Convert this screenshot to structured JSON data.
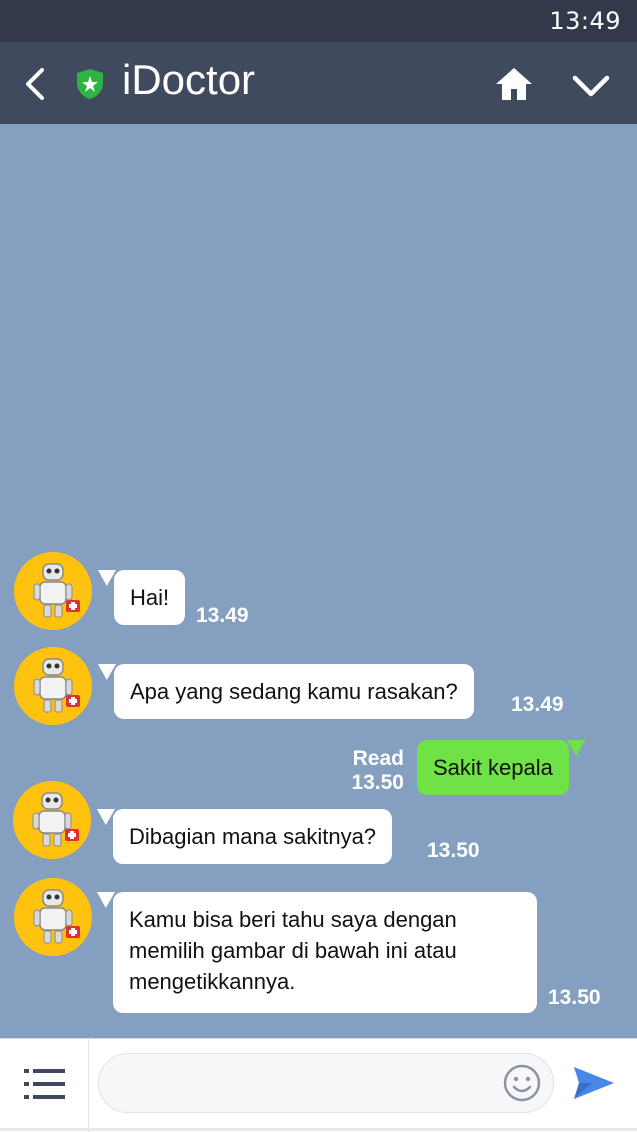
{
  "status_bar": {
    "time": "13:49"
  },
  "header": {
    "title": "iDoctor",
    "icons": {
      "back": "back-chevron-icon",
      "badge": "verified-shield-icon",
      "home": "home-icon",
      "more": "chevron-down-icon"
    },
    "colors": {
      "bar": "#3f4a5e",
      "status": "#31394a",
      "shield": "#2fb343"
    }
  },
  "chat": {
    "background": "#849fc0",
    "messages": [
      {
        "from": "bot",
        "text": "Hai!",
        "time": "13.49"
      },
      {
        "from": "bot",
        "text": "Apa yang sedang kamu rasakan?",
        "time": "13.49"
      },
      {
        "from": "user",
        "text": "Sakit kepala",
        "read": "Read",
        "time": "13.50"
      },
      {
        "from": "bot",
        "text": "Dibagian mana sakitnya?",
        "time": "13.50"
      },
      {
        "from": "bot",
        "text": "Kamu bisa beri tahu saya dengan memilih gambar di bawah ini atau mengetikkannya.",
        "time": "13.50"
      }
    ],
    "bubble_colors": {
      "bot": "#ffffff",
      "user": "#6fe246"
    },
    "avatar_color": "#ffc20e"
  },
  "input_bar": {
    "placeholder": "",
    "icons": {
      "menu": "menu-list-icon",
      "emoji": "emoji-smiley-icon",
      "send": "send-arrow-icon"
    },
    "send_color": "#4a86e8"
  }
}
